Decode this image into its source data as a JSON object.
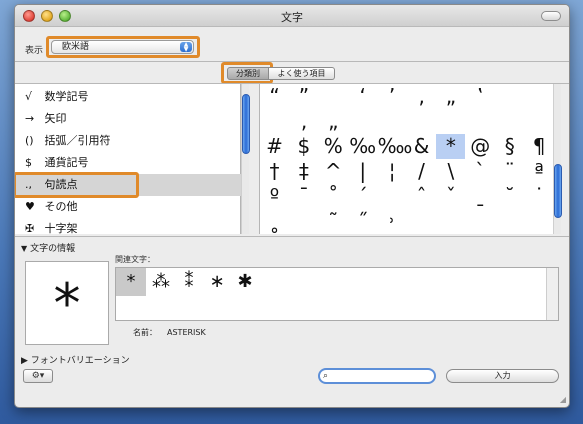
{
  "window": {
    "title": "文字"
  },
  "toolbar": {
    "view_label": "表示",
    "view_value": "欧米語"
  },
  "segments": [
    "分類別",
    "よく使う項目"
  ],
  "categories": [
    {
      "icon": "√",
      "label": "数学記号"
    },
    {
      "icon": "→",
      "label": "矢印"
    },
    {
      "icon": "()",
      "label": "括弧／引用符"
    },
    {
      "icon": "$",
      "label": "通貨記号"
    },
    {
      "icon": ".,",
      "label": "句読点"
    },
    {
      "icon": "♥",
      "label": "その他"
    },
    {
      "icon": "✠",
      "label": "十字架"
    }
  ],
  "selected_category": 4,
  "glyph_rows": [
    [
      "“",
      "”",
      "",
      "‘",
      "’",
      "‚",
      "„",
      "‛"
    ],
    [
      "",
      "‚",
      "„",
      "",
      "",
      "",
      "",
      ""
    ],
    [
      "#",
      "$",
      "%",
      "‰",
      "‱",
      "&",
      "*",
      "@",
      "§",
      "¶"
    ],
    [
      "†",
      "‡",
      "^",
      "|",
      "¦",
      "/",
      "\\",
      "`",
      "¨",
      "ª"
    ],
    [
      "º",
      "¯",
      "˚",
      "ˊ",
      "",
      "ˆ",
      "ˇ",
      "ˍ",
      "˘",
      "˙"
    ],
    [
      "˳",
      "",
      "˜",
      "˝",
      "˒",
      "",
      "",
      "",
      "",
      ""
    ]
  ],
  "info": {
    "header": "文字の情報",
    "preview": "*",
    "related_label": "関連文字：",
    "related": [
      "*",
      "⁂",
      "⁑",
      "∗",
      "✱"
    ],
    "name_label": "名前：",
    "name_value": "ASTERISK"
  },
  "font_variation": "フォントバリエーション",
  "bottom": {
    "gear": "⚙▾",
    "search_value": "",
    "insert": "入力"
  },
  "colors": {
    "accent_highlight": "#e08a2a",
    "selection_blue": "#b9cff3"
  }
}
